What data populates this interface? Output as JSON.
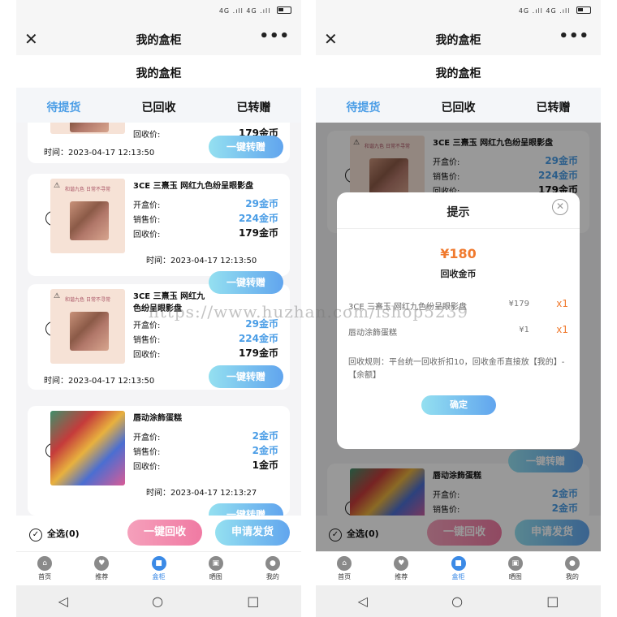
{
  "status_bar": {
    "signal": "4G .ıll 4G .ıll"
  },
  "title_bar": {
    "title": "我的盒柜",
    "close": "✕",
    "more": "•••"
  },
  "page_header": {
    "title": "我的盒柜"
  },
  "tabs": [
    "待提货",
    "已回收",
    "已转赠"
  ],
  "labels": {
    "open_price": "开盒价:",
    "sale_price": "销售价:",
    "recycle_price": "回收价:",
    "time_prefix": "时间：",
    "transfer": "一键转赠"
  },
  "items": [
    {
      "name": "3CE 三熹玉 网红九色纷呈眼影盘",
      "name_wrapped": "3CE 三熹玉 网红九\n色纷呈眼影盘",
      "open_price": "29金币",
      "sale_price": "224金币",
      "recycle_price": "179金币",
      "time": "2023-04-17 12:13:50",
      "thumb_slogan": "和谐九色 日常不寻常"
    },
    {
      "name": "唇动涂飾蛋糕",
      "open_price": "2金币",
      "sale_price": "2金币",
      "recycle_price": "1金币",
      "time": "2023-04-17 12:13:27"
    }
  ],
  "first_card_partial": {
    "recycle_price": "179金币",
    "time": "2023-04-17 12:13:50"
  },
  "bottom_bar": {
    "select_all": "全选(0)",
    "recycle_btn": "一键回收",
    "ship_btn": "申请发货"
  },
  "tabbar": [
    {
      "label": "首页",
      "icon": "home-icon"
    },
    {
      "label": "推荐",
      "icon": "recommend-icon"
    },
    {
      "label": "盒柜",
      "icon": "box-cabinet-icon"
    },
    {
      "label": "晒图",
      "icon": "gallery-icon"
    },
    {
      "label": "我的",
      "icon": "profile-icon"
    }
  ],
  "nav_bar": {
    "back": "◁",
    "home": "○",
    "recent": "□"
  },
  "modal": {
    "title": "提示",
    "amount": "¥180",
    "amount_label": "回收金币",
    "rows": [
      {
        "name": "3CE 三熹玉 网红九色纷呈眼影盘",
        "price": "¥179",
        "qty": "x1"
      },
      {
        "name": "唇动涂飾蛋糕",
        "price": "¥1",
        "qty": "x1"
      }
    ],
    "rule": "回收规则：平台统一回收折扣10，回收金币直接放【我的】-【余额】",
    "ok_button": "确定"
  },
  "watermark": "https://www.huzhan.com/ishop5239",
  "colors": {
    "accent_blue": "#4a9de6",
    "accent_pink": "#f07aa3",
    "amount_orange": "#f07a2e"
  }
}
